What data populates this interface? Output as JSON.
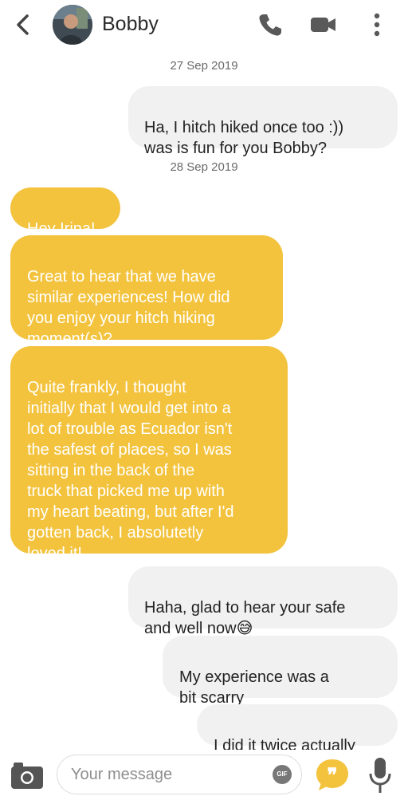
{
  "header": {
    "back_icon": "chevron-left-icon",
    "contact_name": "Bobby",
    "call_icon": "phone-icon",
    "video_icon": "video-camera-icon",
    "menu_icon": "more-vertical-icon"
  },
  "dates": [
    "27 Sep 2019",
    "28 Sep 2019"
  ],
  "messages": [
    {
      "side": "outgoing",
      "text": "Ha, I hitch hiked once too :))\nwas is fun for you Bobby?"
    },
    {
      "side": "incoming",
      "text": "Hey Irina!"
    },
    {
      "side": "incoming",
      "text": "Great to hear that we have\nsimilar experiences! How did\nyou enjoy your hitch hiking\nmoment(s)?"
    },
    {
      "side": "incoming",
      "text": "Quite frankly, I thought\ninitially that I would get into a\nlot of trouble as Ecuador isn't\nthe safest of places, so I was\nsitting in the back of the\ntruck that picked me up with\nmy heart beating, but after I'd\ngotten back, I absolutetly\nloved it!"
    },
    {
      "side": "outgoing",
      "text": "Haha, glad to hear your safe\nand well now",
      "emoji": "😅"
    },
    {
      "side": "outgoing",
      "text": "My experience was a\nbit scarry"
    },
    {
      "side": "outgoing",
      "text": "I did it twice actually"
    }
  ],
  "composer": {
    "camera_icon": "camera-icon",
    "placeholder": "Your message",
    "gif_label": "GIF",
    "quote_icon": "quote-bubble-icon",
    "mic_icon": "microphone-icon"
  },
  "colors": {
    "incoming_bubble": "#f3c33e",
    "outgoing_bubble": "#f1f1f1",
    "icon_gray": "#555555"
  }
}
